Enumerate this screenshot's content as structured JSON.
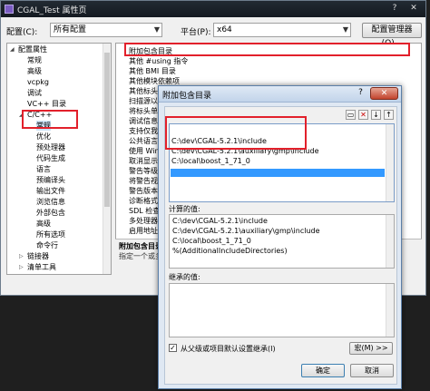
{
  "window": {
    "title": "CGAL_Test 属性页",
    "buttons": {
      "minimize": "?",
      "close": "✕"
    }
  },
  "config": {
    "config_label": "配置(C):",
    "config_value": "所有配置",
    "platform_label": "平台(P):",
    "platform_value": "x64",
    "manager_button": "配置管理器(O)..."
  },
  "tree": {
    "items": [
      {
        "label": "配置属性",
        "depth": 0,
        "expander": "◢"
      },
      {
        "label": "常规",
        "depth": 1
      },
      {
        "label": "高级",
        "depth": 1
      },
      {
        "label": "vcpkg",
        "depth": 1
      },
      {
        "label": "调试",
        "depth": 1
      },
      {
        "label": "VC++ 目录",
        "depth": 1
      },
      {
        "label": "C/C++",
        "depth": 1,
        "expander": "◢"
      },
      {
        "label": "常规",
        "depth": 2,
        "selected": true
      },
      {
        "label": "优化",
        "depth": 2
      },
      {
        "label": "预处理器",
        "depth": 2
      },
      {
        "label": "代码生成",
        "depth": 2
      },
      {
        "label": "语言",
        "depth": 2
      },
      {
        "label": "预编译头",
        "depth": 2
      },
      {
        "label": "输出文件",
        "depth": 2
      },
      {
        "label": "浏览信息",
        "depth": 2
      },
      {
        "label": "外部包含",
        "depth": 2
      },
      {
        "label": "高级",
        "depth": 2
      },
      {
        "label": "所有选项",
        "depth": 2
      },
      {
        "label": "命令行",
        "depth": 2
      },
      {
        "label": "链接器",
        "depth": 1,
        "expander": "▷"
      },
      {
        "label": "清单工具",
        "depth": 1,
        "expander": "▷"
      }
    ]
  },
  "props": {
    "items": [
      "附加包含目录",
      "其他 #using 指令",
      "其他 BMI 目录",
      "其他模块依赖项",
      "其他标头单元",
      "扫描源以查找",
      "将标头单元",
      "调试信息格式",
      "支持仅我的",
      "公共语言运行",
      "使用 Wind",
      "取消显示启",
      "警告等级",
      "将警告视为",
      "警告版本",
      "诊断格式",
      "SDL 检查",
      "多处理器编",
      "启用地址消"
    ],
    "desc_title": "附加包含目录",
    "desc_text": "指定一个或多"
  },
  "dialog": {
    "title": "附加包含目录",
    "help": "?",
    "close": "✕",
    "toolbar": {
      "new_folder": "▭",
      "delete": "✕",
      "down": "↓",
      "up": "↑"
    },
    "entries": [
      "C:\\dev\\CGAL-5.2.1\\include",
      "C:\\dev\\CGAL-5.2.1\\auxiliary\\gmp\\include",
      "C:\\local\\boost_1_71_0"
    ],
    "computed_label": "计算的值:",
    "computed_values": [
      "C:\\dev\\CGAL-5.2.1\\include",
      "C:\\dev\\CGAL-5.2.1\\auxiliary\\gmp\\include",
      "C:\\local\\boost_1_71_0",
      "%(AdditionalIncludeDirectories)"
    ],
    "inherited_label": "继承的值:",
    "inherit_checkbox": "从父级或项目默认设置继承(I)",
    "macro_button": "宏(M) >>",
    "ok_button": "确定",
    "cancel_button": "取消"
  },
  "colors": {
    "highlight": "#e2202b",
    "selection": "#3399ff"
  }
}
